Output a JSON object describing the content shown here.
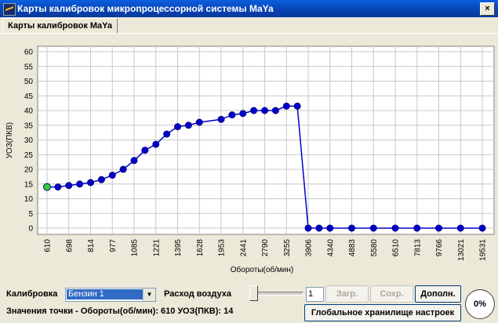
{
  "window": {
    "title": "Карты калибровок микропроцессорной системы MaYa",
    "close_label": "×"
  },
  "tabs": [
    {
      "label": "Карты калибровок MaYa",
      "active": true
    }
  ],
  "chart_data": {
    "type": "line",
    "xlabel": "Обороты(об/мин)",
    "ylabel": "УОЗ(ПКВ)",
    "ylim": [
      0,
      60
    ],
    "yticks": [
      0,
      5,
      10,
      15,
      20,
      25,
      30,
      35,
      40,
      45,
      50,
      55,
      60
    ],
    "grid": true,
    "x": [
      610,
      698,
      814,
      977,
      1085,
      1221,
      1395,
      1628,
      1953,
      2441,
      2790,
      3255,
      3906,
      4340,
      4883,
      5580,
      6510,
      7813,
      9766,
      13021,
      19531
    ],
    "xtick_labels": [
      "610",
      "698",
      "814",
      "977",
      "1085",
      "1221",
      "1395",
      "1628",
      "1953",
      "2441",
      "2790",
      "3255",
      "3906",
      "4340",
      "4883",
      "5580",
      "6510",
      "7813",
      "9766",
      "13021",
      "19531"
    ],
    "point_slots": [
      0,
      0.5,
      1,
      1.5,
      2,
      2.5,
      3,
      3.5,
      4,
      4.5,
      5,
      5.5,
      6,
      6.5,
      7,
      8,
      8.5,
      9,
      9.5,
      10,
      10.5,
      11,
      11.5,
      12,
      12.5,
      13,
      14,
      15,
      16,
      17,
      18,
      19,
      20
    ],
    "series": [
      {
        "values": [
          14,
          14,
          14.5,
          15,
          15.5,
          16.5,
          18,
          20,
          23,
          26.5,
          28.5,
          32,
          34.5,
          35,
          36,
          37,
          38.5,
          39,
          40,
          40,
          40,
          41.5,
          41.5,
          0,
          0,
          0,
          0,
          0,
          0,
          0,
          0,
          0,
          0
        ],
        "color": "#0000cc"
      }
    ],
    "selected_point_index": 0,
    "selected_color": "#33cc33"
  },
  "controls": {
    "calibration_label": "Калибровка",
    "calibration_value": "Бензин 1",
    "airflow_label": "Расход воздуха",
    "airflow_value": "1",
    "load_button": "Загр.",
    "save_button": "Сохр.",
    "extra_button": "Дополн.",
    "global_storage_button": "Глобальное хранилище настроек",
    "progress_text": "0%"
  },
  "status": {
    "text": "Значения точки - Обороты(об/мин): 610   УОЗ(ПКВ): 14"
  }
}
